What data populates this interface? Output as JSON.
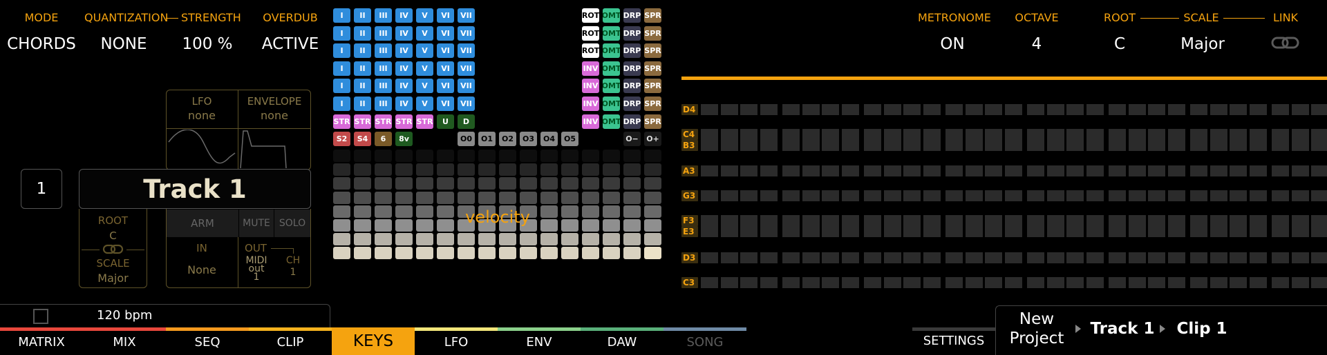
{
  "top_left": {
    "mode_label": "MODE",
    "mode_value": "CHORDS",
    "quant_label": "QUANTIZATION",
    "quant_value": "NONE",
    "strength_label": "STRENGTH",
    "strength_value": "100 %",
    "overdub_label": "OVERDUB",
    "overdub_value": "ACTIVE"
  },
  "track_panel": {
    "lfo_label": "LFO",
    "lfo_value": "none",
    "env_label": "ENVELOPE",
    "env_value": "none",
    "track_number": "1",
    "track_name": "Track 1",
    "root_label": "ROOT",
    "root_value": "C",
    "scale_label": "SCALE",
    "scale_value": "Major",
    "arm_label": "ARM",
    "mute_label": "MUTE",
    "solo_label": "SOLO",
    "in_label": "IN",
    "in_value": "None",
    "out_label": "OUT",
    "out_value_1": "MIDI",
    "out_value_2": "out",
    "out_value_3": "1",
    "ch_label": "CH",
    "ch_value": "1"
  },
  "pad_grid": {
    "degrees": [
      "I",
      "II",
      "III",
      "IV",
      "V",
      "VI",
      "VII"
    ],
    "right_buttons": [
      [
        "ROT",
        "OMT",
        "DRP",
        "SPR"
      ],
      [
        "ROT",
        "OMT",
        "DRP",
        "SPR"
      ],
      [
        "ROT",
        "OMT",
        "DRP",
        "SPR"
      ],
      [
        "INV",
        "OMT",
        "DRP",
        "SPR"
      ],
      [
        "INV",
        "OMT",
        "DRP",
        "SPR"
      ],
      [
        "INV",
        "OMT",
        "DRP",
        "SPR"
      ],
      [
        "INV",
        "OMT",
        "DRP",
        "SPR"
      ]
    ],
    "str_row": [
      "STR",
      "STR",
      "STR",
      "STR",
      "STR",
      "U",
      "D"
    ],
    "mod_row": [
      "S2",
      "S4",
      "6",
      "8v"
    ],
    "octave_row": [
      "O0",
      "O1",
      "O2",
      "O3",
      "O4",
      "O5"
    ],
    "octave_shift": [
      "O−",
      "O+"
    ],
    "velocity_label": "velocity",
    "colors": {
      "degree": "#2f8ddc",
      "str": "#d86ad8",
      "rot": "#ffffff",
      "inv": "#d86ad8",
      "omt": "#3bc490",
      "drp": "#3a3a50",
      "spr": "#8b6a3e",
      "s": "#c24a4a",
      "six": "#7a5a28",
      "eightv": "#1e5a20",
      "u": "#205a20",
      "oct": "#8a8a8a"
    }
  },
  "top_right": {
    "metronome_label": "METRONOME",
    "metronome_value": "ON",
    "octave_label": "OCTAVE",
    "octave_value": "4",
    "root_label": "ROOT",
    "root_value": "C",
    "scale_label": "SCALE",
    "scale_value": "Major",
    "link_label": "LINK"
  },
  "piano_roll": {
    "notes": [
      "D4",
      "C4",
      "B3",
      "A3",
      "G3",
      "F3",
      "E3",
      "D3",
      "C3"
    ]
  },
  "status": {
    "bpm": "120 bpm"
  },
  "nav": {
    "tabs": [
      "MATRIX",
      "MIX",
      "SEQ",
      "CLIP",
      "KEYS",
      "LFO",
      "ENV",
      "DAW",
      "SONG"
    ],
    "active_tab": "KEYS",
    "tab_colors": [
      "#e8483c",
      "#e8483c",
      "#f59a1e",
      "#f5b21e",
      "#f5a30f",
      "#f2e67a",
      "#8bd18b",
      "#5ab07a",
      "#6f8aa6"
    ],
    "settings_label": "SETTINGS",
    "breadcrumb_project_1": "New",
    "breadcrumb_project_2": "Project",
    "breadcrumb_track": "Track 1",
    "breadcrumb_clip": "Clip 1",
    "accent": "#f5a30f"
  }
}
